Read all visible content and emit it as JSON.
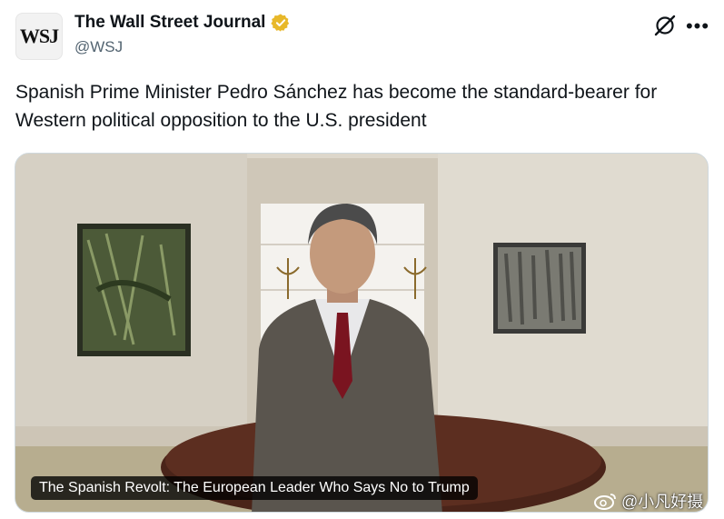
{
  "account": {
    "avatar_text": "WSJ",
    "display_name": "The Wall Street Journal",
    "handle": "@WSJ",
    "verified_color": "#e8b829"
  },
  "icons": {
    "grok": "grok-icon",
    "more": "more-icon",
    "verified": "verified-badge-icon",
    "weibo": "weibo-icon"
  },
  "tweet": {
    "text": "Spanish Prime Minister Pedro Sánchez has become the standard-bearer for Western political opposition to the U.S. president"
  },
  "media": {
    "caption": "The Spanish Revolt: The European Leader Who Says No to Trump"
  },
  "watermark": {
    "text": "@小凡好摄"
  }
}
